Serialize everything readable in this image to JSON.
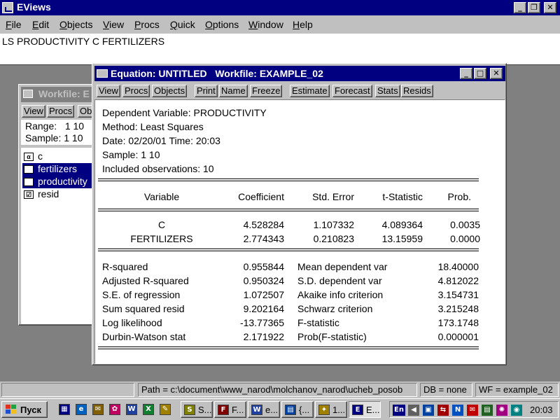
{
  "app": {
    "title": "EViews",
    "menu": [
      "File",
      "Edit",
      "Objects",
      "View",
      "Procs",
      "Quick",
      "Options",
      "Window",
      "Help"
    ],
    "window_controls": {
      "minimize": "_",
      "restore": "❐",
      "close": "✕"
    }
  },
  "command": {
    "text": "LS PRODUCTIVITY C FERTILIZERS"
  },
  "workfile": {
    "title": "Workfile: E",
    "toolbar": [
      "View",
      "Procs",
      "Ob"
    ],
    "range_label": "Range:",
    "range_value": "1 10",
    "sample_label": "Sample:",
    "sample_value": "1 10",
    "objects": [
      {
        "name": "c",
        "icon": "alpha-icon",
        "icon_glyph": "α",
        "selected": false
      },
      {
        "name": "fertilizers",
        "icon": "series-icon",
        "icon_glyph": "☑",
        "selected": true
      },
      {
        "name": "productivity",
        "icon": "series-icon",
        "icon_glyph": "☑",
        "selected": true
      },
      {
        "name": "resid",
        "icon": "series-icon",
        "icon_glyph": "☑",
        "selected": false
      }
    ]
  },
  "equation": {
    "title": "Equation: UNTITLED   Workfile: EXAMPLE_02",
    "toolbar_group1": [
      "View",
      "Procs",
      "Objects"
    ],
    "toolbar_group2": [
      "Print",
      "Name",
      "Freeze"
    ],
    "toolbar_group3": [
      "Estimate",
      "Forecast",
      "Stats",
      "Resids"
    ],
    "header": {
      "dependent_variable": "Dependent Variable: PRODUCTIVITY",
      "method": "Method: Least Squares",
      "date_time": "Date: 02/20/01   Time: 20:03",
      "sample": "Sample: 1 10",
      "observations": "Included observations: 10"
    },
    "columns": [
      "Variable",
      "Coefficient",
      "Std. Error",
      "t-Statistic",
      "Prob."
    ],
    "rows": [
      {
        "variable": "C",
        "coefficient": "4.528284",
        "std_error": "1.107332",
        "t_stat": "4.089364",
        "prob": "0.0035"
      },
      {
        "variable": "FERTILIZERS",
        "coefficient": "2.774343",
        "std_error": "0.210823",
        "t_stat": "13.15959",
        "prob": "0.0000"
      }
    ],
    "stats_left": [
      {
        "label": "R-squared",
        "value": "0.955844"
      },
      {
        "label": "Adjusted R-squared",
        "value": "0.950324"
      },
      {
        "label": "S.E. of regression",
        "value": "1.072507"
      },
      {
        "label": "Sum squared resid",
        "value": "9.202164"
      },
      {
        "label": "Log likelihood",
        "value": "-13.77365"
      },
      {
        "label": "Durbin-Watson stat",
        "value": "2.171922"
      }
    ],
    "stats_right": [
      {
        "label": "Mean dependent var",
        "value": "18.40000"
      },
      {
        "label": "S.D. dependent var",
        "value": "4.812022"
      },
      {
        "label": "Akaike info criterion",
        "value": "3.154731"
      },
      {
        "label": "Schwarz criterion",
        "value": "3.215248"
      },
      {
        "label": "F-statistic",
        "value": "173.1748"
      },
      {
        "label": "Prob(F-statistic)",
        "value": "0.000001"
      }
    ]
  },
  "status": {
    "path": "Path = c:\\document\\www_narod\\molchanov_narod\\ucheb_posob",
    "db": "DB = none",
    "wf": "WF = example_02"
  },
  "taskbar": {
    "start_label": "Пуск",
    "quicklaunch": [
      {
        "icon": "windows-explorer-icon",
        "glyph": "▦",
        "color": "#000080"
      },
      {
        "icon": "internet-explorer-icon",
        "glyph": "e",
        "color": "#0060c0"
      },
      {
        "icon": "outlook-express-icon",
        "glyph": "✉",
        "color": "#806000"
      },
      {
        "icon": "media-icon",
        "glyph": "✿",
        "color": "#c00060"
      },
      {
        "icon": "word-icon",
        "glyph": "W",
        "color": "#2040a0"
      },
      {
        "icon": "excel-icon",
        "glyph": "X",
        "color": "#108030"
      },
      {
        "icon": "tool-icon",
        "glyph": "✎",
        "color": "#a08000"
      }
    ],
    "tasks": [
      {
        "label": "S...",
        "icon": "s-task-icon",
        "glyph": "S",
        "color": "#808000",
        "active": false
      },
      {
        "label": "F...",
        "icon": "far-icon",
        "glyph": "F",
        "color": "#800000",
        "active": false
      },
      {
        "label": "e...",
        "icon": "word-doc-icon",
        "glyph": "W",
        "color": "#2040a0",
        "active": false
      },
      {
        "label": "{...",
        "icon": "app-task-icon",
        "glyph": "▤",
        "color": "#0040a0",
        "active": false
      },
      {
        "label": "1...",
        "icon": "plugin-task-icon",
        "glyph": "✦",
        "color": "#a08000",
        "active": false
      },
      {
        "label": "E...",
        "icon": "eviews-task-icon",
        "glyph": "E",
        "color": "#000080",
        "active": true
      }
    ],
    "tray": {
      "language": "En",
      "clock": "20:03",
      "icons": [
        {
          "icon": "volume-icon",
          "glyph": "◀",
          "color": "#606060"
        },
        {
          "icon": "monitor-icon",
          "glyph": "▣",
          "color": "#0040a0"
        },
        {
          "icon": "network-icon",
          "glyph": "⇆",
          "color": "#a00000"
        },
        {
          "icon": "antivirus-icon",
          "glyph": "N",
          "color": "#0050c0"
        },
        {
          "icon": "mail-icon",
          "glyph": "✉",
          "color": "#c00000"
        },
        {
          "icon": "display-icon",
          "glyph": "▤",
          "color": "#206020"
        },
        {
          "icon": "settings-icon",
          "glyph": "✺",
          "color": "#a00080"
        },
        {
          "icon": "globe-icon",
          "glyph": "◉",
          "color": "#008080"
        }
      ]
    }
  }
}
